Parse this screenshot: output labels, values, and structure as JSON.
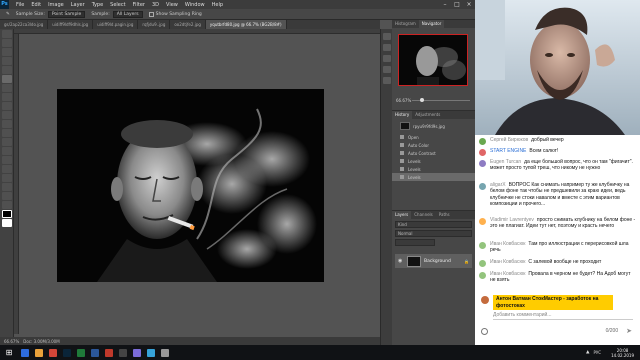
{
  "photoshop": {
    "menu": [
      "File",
      "Edit",
      "Image",
      "Layer",
      "Type",
      "Select",
      "Filter",
      "3D",
      "View",
      "Window",
      "Help"
    ],
    "options": {
      "sample_size_label": "Sample Size:",
      "sample_size_value": "Point Sample",
      "sample_label": "Sample:",
      "sample_value": "All Layers",
      "show_ring_label": "Show Sampling Ring"
    },
    "tabs": [
      "gs/2ap22ca3ldo.jpg",
      "uidiff9ldf9dhls.jpg",
      "uidiff9ld.pagin.jpg",
      "rqfjdu9..jpg",
      "oo2dtjfe2.jpg",
      "yqutbrfd80.jpg @ 66.7% (BG2B/8#)"
    ],
    "status": {
      "zoom": "66.67%",
      "doc": "Doc: 3.00M/3.00M"
    },
    "navigator": {
      "tabs": [
        "Histogram",
        "Navigator"
      ],
      "zoom": "66.67%"
    },
    "history": {
      "tabs": [
        "History",
        "Adjustments"
      ],
      "items": [
        "rpyu9r9fd9s.jpg",
        "Open",
        "Auto Color",
        "Auto Contrast",
        "Levels",
        "Levels",
        "Levels"
      ]
    },
    "layers": {
      "tabs": [
        "Layers",
        "Channels",
        "Paths"
      ],
      "kind": "Kind",
      "blend": "Normal",
      "layer_name": "Background"
    }
  },
  "chat": {
    "messages": [
      {
        "author": "Сергей Бирюков",
        "text": "добрый вечер",
        "author_color": "gray",
        "avatar_color": "#6aa84f"
      },
      {
        "author": "START ENGINE",
        "text": "Всем салют!",
        "author_color": "blue",
        "avatar_color": "#e06666"
      },
      {
        "author": "Eugen Turcan",
        "text": "да еще большой вопрос, что он там \"фигачит\". может просто тупой треш, что никому не нужно",
        "author_color": "gray",
        "avatar_color": "#8e7cc3"
      },
      {
        "author": "aligarX",
        "text": "ВОПРОС Как снимать например ту же клубничку на белом фоне так чтобы не предшевили за краю идеи, ведь клубничке не стоки навалом и вместе с этим вариантов композиции и прочего...",
        "author_color": "gray",
        "avatar_color": "#76a5af"
      },
      {
        "author": "Vladimir Lavrentyev",
        "text": "просто снимать клубнику на белом фоне - это не плагиат. Идеи тут нет, поэтому и красть нечего",
        "author_color": "gray",
        "avatar_color": "#ffb14e"
      },
      {
        "author": "Иван Ковбасюк",
        "text": "Там про иллюстрации с перерисовкой шла речь",
        "author_color": "gray",
        "avatar_color": "#93c47d"
      },
      {
        "author": "Иван Ковбасюк",
        "text": "С залевой вообще не проходит",
        "author_color": "gray",
        "avatar_color": "#93c47d"
      },
      {
        "author": "Иван Ковбасюк",
        "text": "Провала в черном не будет? На Адоб могут не взять",
        "author_color": "gray",
        "avatar_color": "#93c47d"
      }
    ],
    "pinned": {
      "author": "Антон Ватман",
      "text": "СтокМастер - заработок на фотостоках"
    },
    "input_placeholder": "Добавить комментарий...",
    "char_count": "0/200"
  },
  "taskbar": {
    "time": "20:08",
    "date": "14.02.2019",
    "lang": "РУС"
  }
}
